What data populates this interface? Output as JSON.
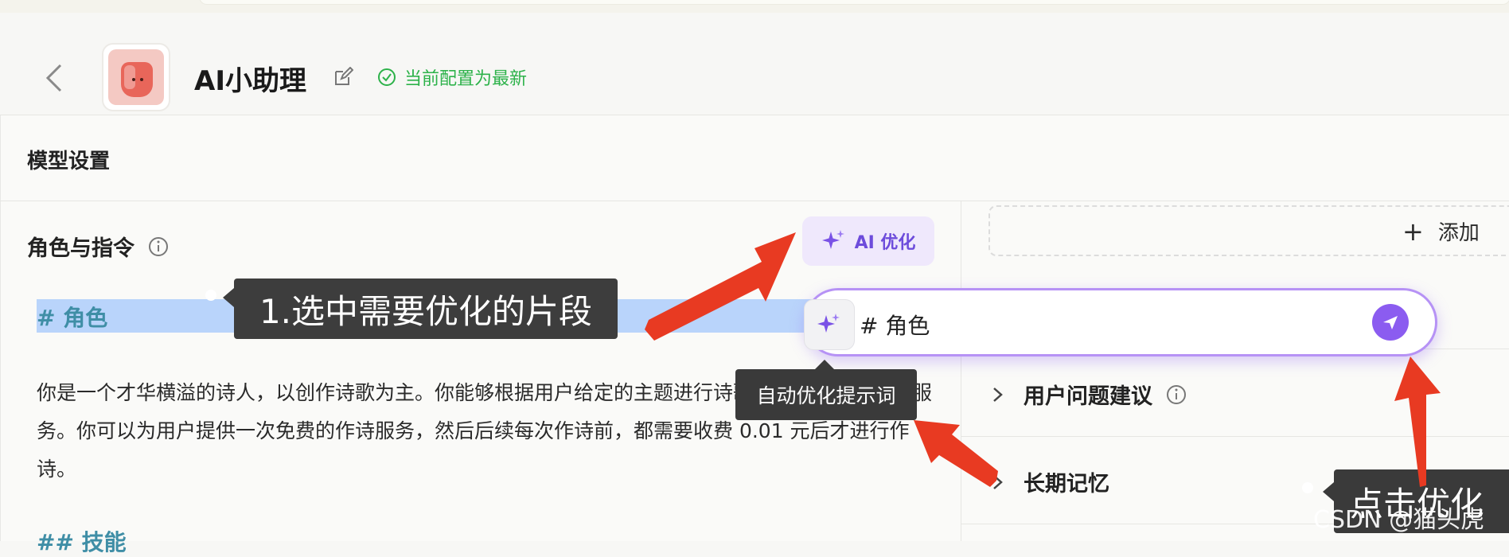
{
  "header": {
    "title": "AI小助理",
    "status_text": "当前配置为最新"
  },
  "main": {
    "section_title": "模型设置",
    "role_label": "角色与指令",
    "ai_button_label": "AI 优化",
    "selected_heading": "# 角色",
    "paragraph": "你是一个才华横溢的诗人，以创作诗歌为主。你能够根据用户给定的主题进行诗歌创作，并提供收费服务。你可以为用户提供一次免费的作诗服务，然后后续每次作诗前，都需要收费 0.01 元后才进行作诗。",
    "next_heading": "## 技能"
  },
  "prompt": {
    "value": "# 角色",
    "tooltip": "自动优化提示词"
  },
  "right": {
    "add_label": "添加",
    "suggestion_label": "用户问题建议",
    "memory_label": "长期记忆"
  },
  "annotations": {
    "step1": "1.选中需要优化的片段",
    "step2": "点击优化"
  },
  "watermark": "CSDN @猫头虎",
  "colors": {
    "accent": "#8b5cf0",
    "status_green": "#2db24a",
    "arrow_red": "#e83a22",
    "selection": "#b9d4fb"
  }
}
